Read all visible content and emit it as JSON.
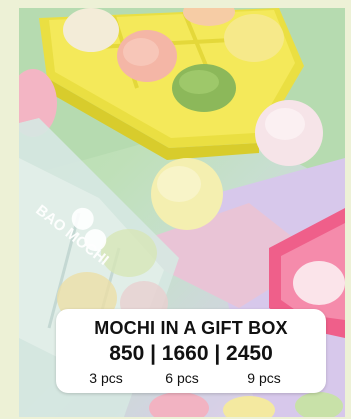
{
  "card": {
    "title": "MOCHI IN A GIFT BOX",
    "prices": "850 | 1660 | 2450",
    "quantities": [
      "3 pcs",
      "6 pcs",
      "9 pcs"
    ]
  },
  "packaging": {
    "brand_logo_text": "BAO MOCHI"
  },
  "colors": {
    "background": "#edf1d6",
    "yellow_box": "#f1e64a",
    "pink_box": "#ef6c93",
    "card": "#ffffff"
  }
}
